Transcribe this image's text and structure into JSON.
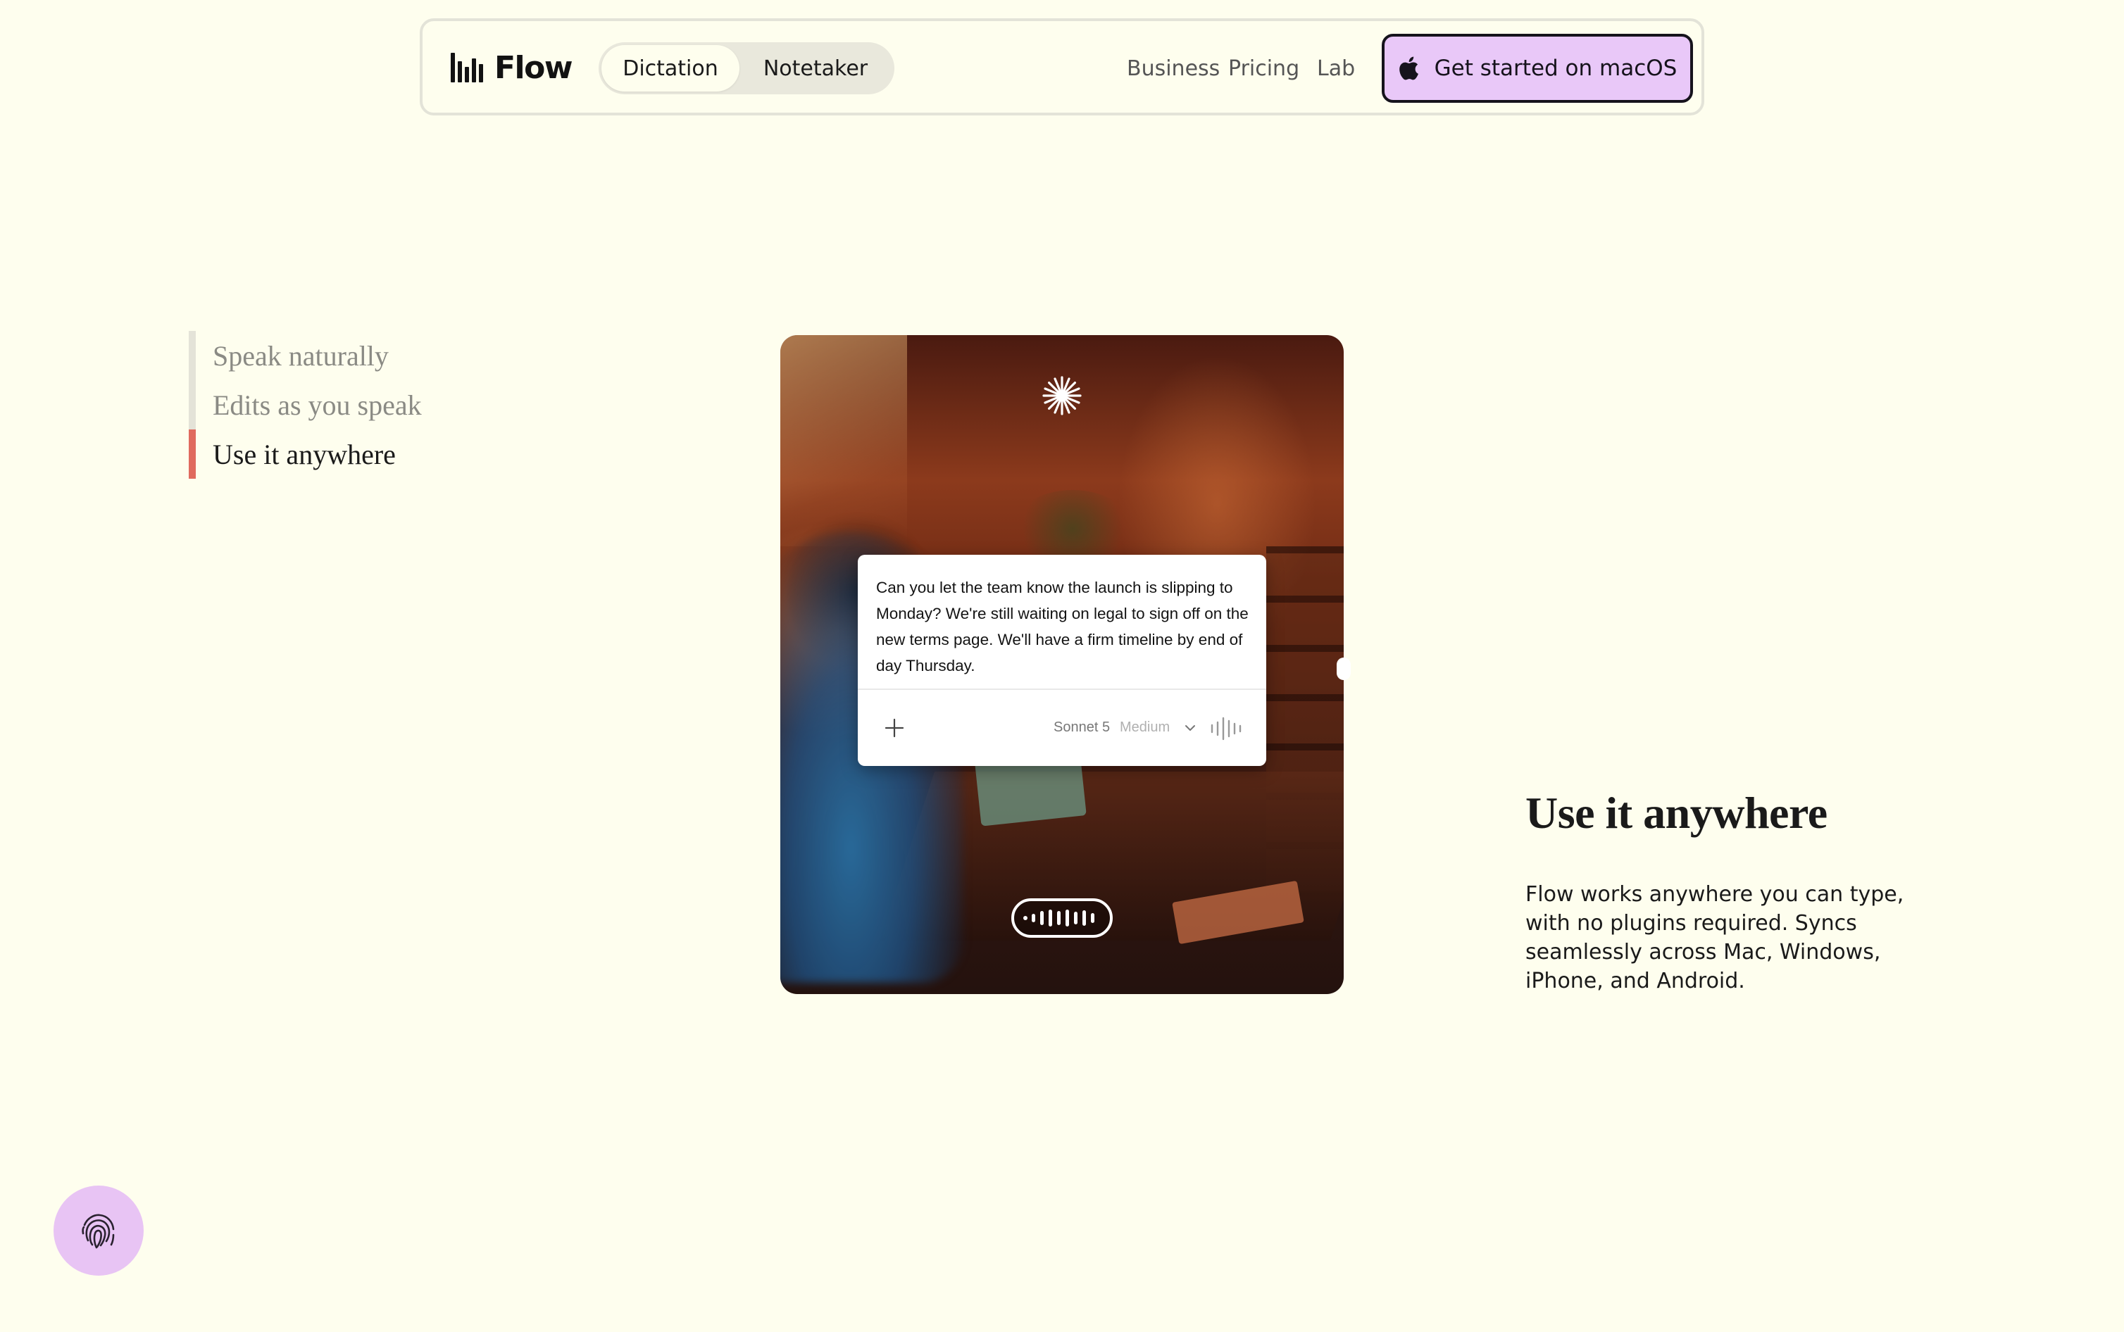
{
  "nav": {
    "logo_text": "Flow",
    "mode_tabs": [
      {
        "label": "Dictation",
        "active": true
      },
      {
        "label": "Notetaker",
        "active": false
      }
    ],
    "links": [
      "Business",
      "Pricing",
      "Lab"
    ],
    "cta_label": "Get started on macOS"
  },
  "features": [
    {
      "label": "Speak naturally",
      "active": false
    },
    {
      "label": "Edits as you speak",
      "active": false
    },
    {
      "label": "Use it anywhere",
      "active": true
    }
  ],
  "demo": {
    "dictation_text": "Can you let the team know the launch is slipping to Monday? We're still waiting on legal to sign off on the new terms page. We'll have a firm timeline by end of day Thursday.",
    "model_name": "Sonnet 5",
    "model_level": "Medium"
  },
  "content": {
    "headline": "Use it anywhere",
    "body": "Flow works anywhere you can type, with no plugins required. Syncs seamlessly across Mac, Windows, iPhone, and Android."
  },
  "colors": {
    "background": "#FEFEEE",
    "cta_fill": "#E9C8F8",
    "active_indicator": "#e06a5e",
    "fab_fill": "#E8C4F4"
  },
  "icons": {
    "logo": "waveform-bars-icon",
    "cta": "apple-icon",
    "demo_top": "sparkle-icon",
    "dictation_add": "plus-icon",
    "model_dropdown": "chevron-down-icon",
    "dictation_voice": "waveform-icon",
    "fab": "fingerprint-icon"
  }
}
